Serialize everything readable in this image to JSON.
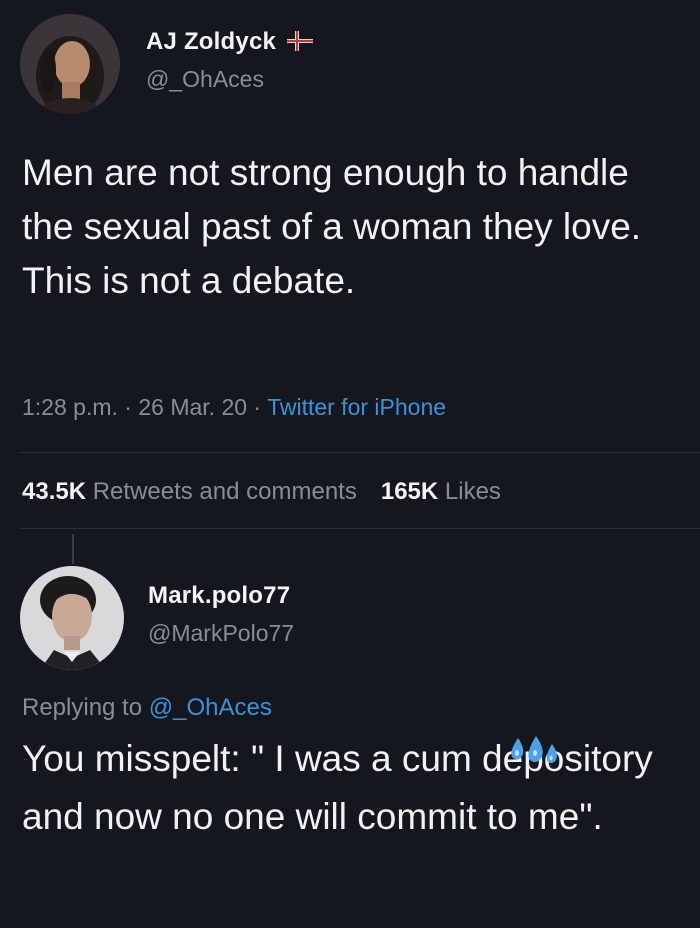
{
  "tweet": {
    "display_name": "AJ Zoldyck",
    "handle": "@_OhAces",
    "text": "Men are not strong enough to handle the sexual past of a woman they love. This is not a debate.",
    "time": "1:28 p.m.",
    "date": "26 Mar. 20",
    "source": "Twitter for iPhone",
    "retweets_count": "43.5K",
    "retweets_label": "Retweets and comments",
    "likes_count": "165K",
    "likes_label": "Likes",
    "flag_icon": "flag-icon"
  },
  "reply": {
    "display_name": "Mark.polo77",
    "handle": "@MarkPolo77",
    "replying_prefix": "Replying to",
    "replying_mention": "@_OhAces",
    "text": "You misspelt: \" I was a cum depository and now no one will commit to me\".",
    "emoji_icon": "sweat-droplets-icon"
  },
  "colors": {
    "background": "#15171f",
    "text": "#f2f2f4",
    "secondary_text": "#8a8d96",
    "link": "#3a93d9"
  }
}
